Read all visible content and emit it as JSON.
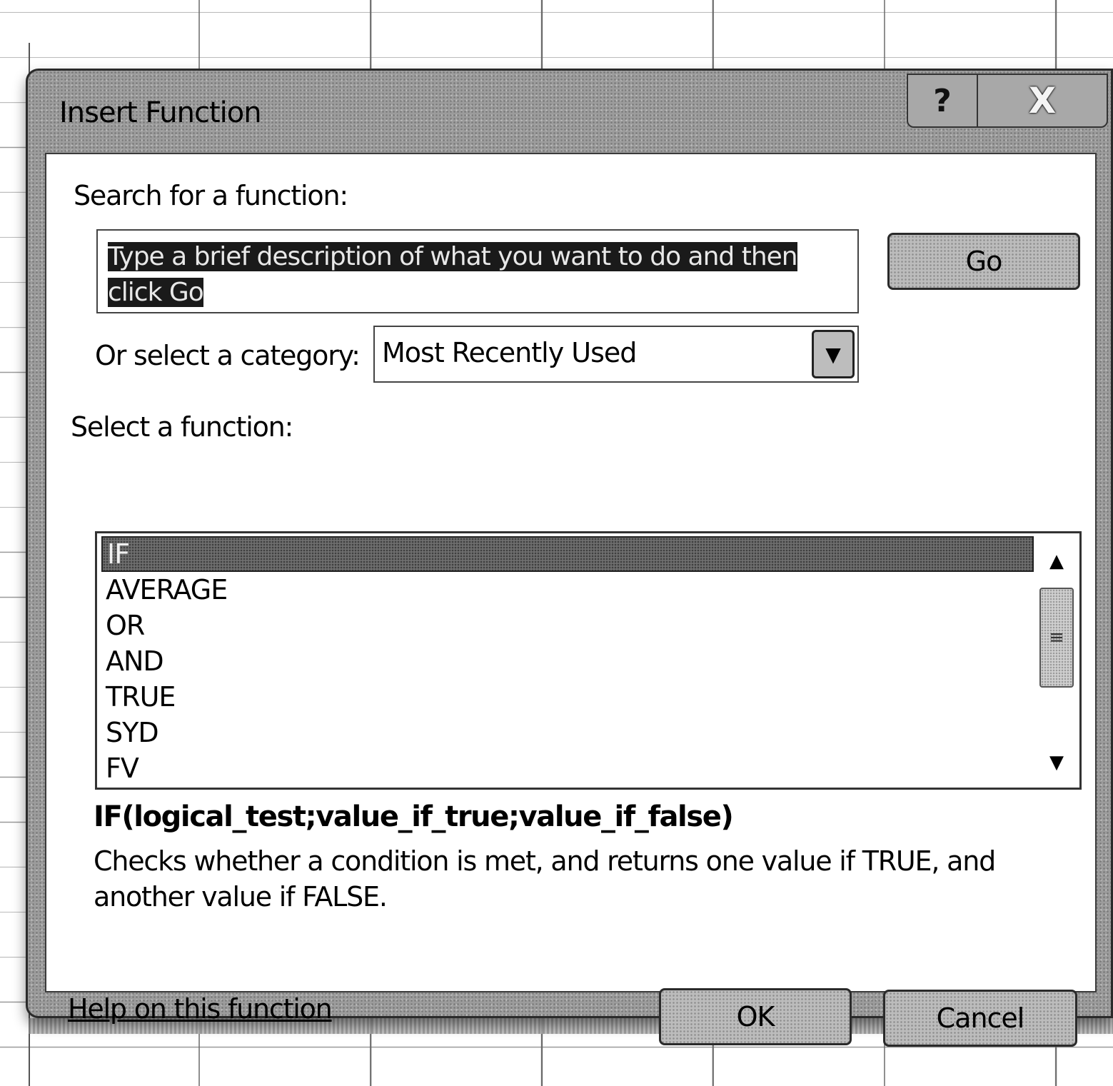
{
  "dialog": {
    "title": "Insert Function",
    "help_button": "?",
    "close_button": "X"
  },
  "search": {
    "label": "Search for a function:",
    "value_line1": "Type a brief description of what you want to do and then",
    "value_line2": "click Go",
    "go_label": "Go"
  },
  "category": {
    "label": "Or select a category:",
    "selected": "Most Recently Used",
    "arrow_icon": "chevron-down-icon"
  },
  "functions": {
    "label": "Select a function:",
    "items": [
      "IF",
      "AVERAGE",
      "OR",
      "AND",
      "TRUE",
      "SYD",
      "FV"
    ],
    "selected_index": 0
  },
  "detail": {
    "syntax": "IF(logical_test;value_if_true;value_if_false)",
    "description": "Checks whether a condition is met, and returns one value if TRUE, and another value if FALSE."
  },
  "footer": {
    "help_link": "Help on this function",
    "ok_label": "OK",
    "cancel_label": "Cancel"
  }
}
